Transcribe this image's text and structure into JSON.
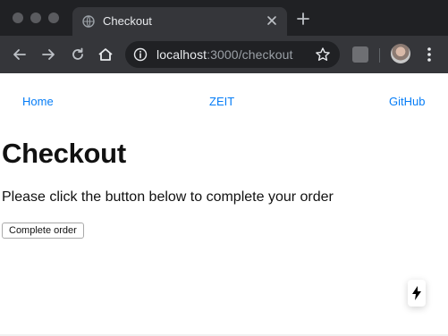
{
  "browser": {
    "tab_title": "Checkout",
    "url_host": "localhost",
    "url_path": ":3000/checkout",
    "icons": {
      "tab_favicon": "globe-icon",
      "tab_close": "close-icon",
      "new_tab": "plus-icon",
      "back": "back-arrow-icon",
      "forward": "forward-arrow-icon",
      "reload": "reload-icon",
      "home": "home-icon",
      "site_info": "info-icon",
      "bookmark": "star-icon",
      "extension": "extension-icon",
      "profile": "avatar",
      "menu": "kebab-menu-icon"
    }
  },
  "nav": {
    "home": "Home",
    "zeit": "ZEIT",
    "github": "GitHub"
  },
  "main": {
    "title": "Checkout",
    "text": "Please click the button below to complete your order",
    "button_label": "Complete order"
  },
  "colors": {
    "link": "#067df7",
    "chrome_dark": "#202124",
    "chrome_toolbar": "#35363a"
  }
}
